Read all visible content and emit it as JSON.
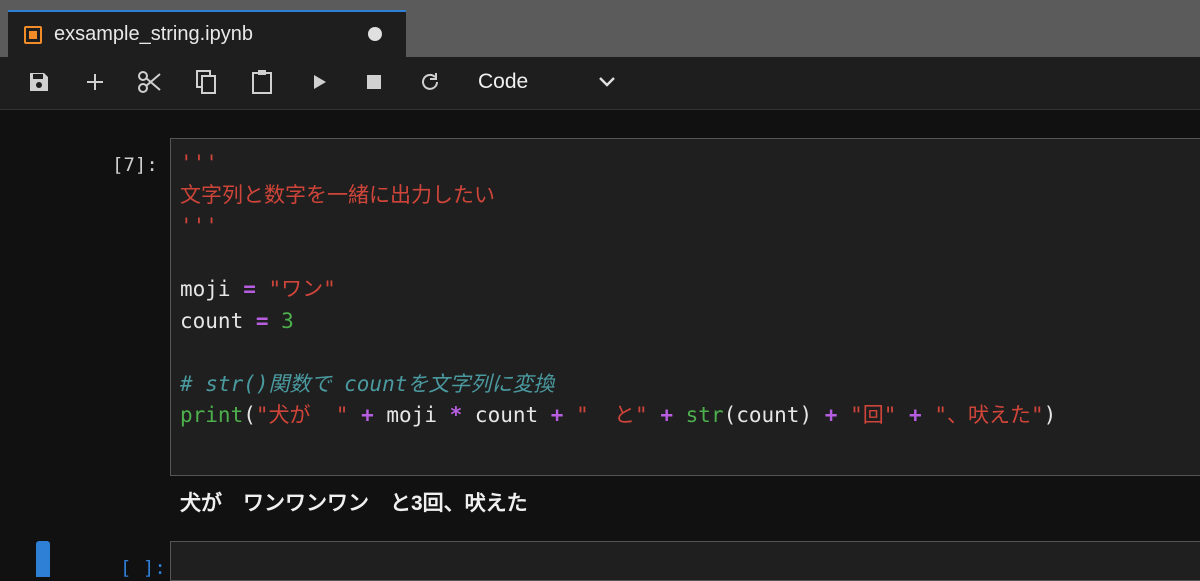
{
  "tab": {
    "title": "exsample_string.ipynb",
    "icon": "notebook-icon",
    "modified_indicator": "unsaved-dot"
  },
  "toolbar": {
    "buttons": [
      "save-icon",
      "plus-icon",
      "scissors-icon",
      "copy-icon",
      "paste-icon",
      "run-icon",
      "stop-icon",
      "restart-icon"
    ],
    "cell_type": "Code"
  },
  "cells": [
    {
      "prompt": "[7]:",
      "lines": [
        [
          {
            "t": "'''",
            "c": "str"
          }
        ],
        [
          {
            "t": "文字列と数字を一緒に出力したい",
            "c": "str"
          }
        ],
        [
          {
            "t": "'''",
            "c": "str"
          }
        ],
        [],
        [
          {
            "t": "moji ",
            "c": ""
          },
          {
            "t": "=",
            "c": "op"
          },
          {
            "t": " ",
            "c": ""
          },
          {
            "t": "\"ワン\"",
            "c": "str"
          }
        ],
        [
          {
            "t": "count ",
            "c": ""
          },
          {
            "t": "=",
            "c": "op"
          },
          {
            "t": " ",
            "c": ""
          },
          {
            "t": "3",
            "c": "num"
          }
        ],
        [],
        [
          {
            "t": "# str()関数で countを文字列に変換",
            "c": "cmt"
          }
        ],
        [
          {
            "t": "print",
            "c": "kw"
          },
          {
            "t": "(",
            "c": ""
          },
          {
            "t": "\"犬が  \"",
            "c": "str"
          },
          {
            "t": " ",
            "c": ""
          },
          {
            "t": "+",
            "c": "op"
          },
          {
            "t": " moji ",
            "c": ""
          },
          {
            "t": "*",
            "c": "op"
          },
          {
            "t": " count ",
            "c": ""
          },
          {
            "t": "+",
            "c": "op"
          },
          {
            "t": " ",
            "c": ""
          },
          {
            "t": "\"  と\"",
            "c": "str"
          },
          {
            "t": " ",
            "c": ""
          },
          {
            "t": "+",
            "c": "op"
          },
          {
            "t": " ",
            "c": ""
          },
          {
            "t": "str",
            "c": "kw"
          },
          {
            "t": "(count) ",
            "c": ""
          },
          {
            "t": "+",
            "c": "op"
          },
          {
            "t": " ",
            "c": ""
          },
          {
            "t": "\"回\"",
            "c": "str"
          },
          {
            "t": " ",
            "c": ""
          },
          {
            "t": "+",
            "c": "op"
          },
          {
            "t": " ",
            "c": ""
          },
          {
            "t": "\"、吠えた\"",
            "c": "str"
          },
          {
            "t": ")",
            "c": ""
          }
        ]
      ],
      "output": "犬が　ワンワンワン　と3回、吠えた"
    },
    {
      "prompt": "[ ]:"
    }
  ],
  "colors": {
    "string": "#d0453a",
    "keyword": "#4db04d",
    "operator": "#b75ee0",
    "comment": "#4a9aa0",
    "accent": "#2e7fd6",
    "notebook_icon": "#f28c28"
  }
}
